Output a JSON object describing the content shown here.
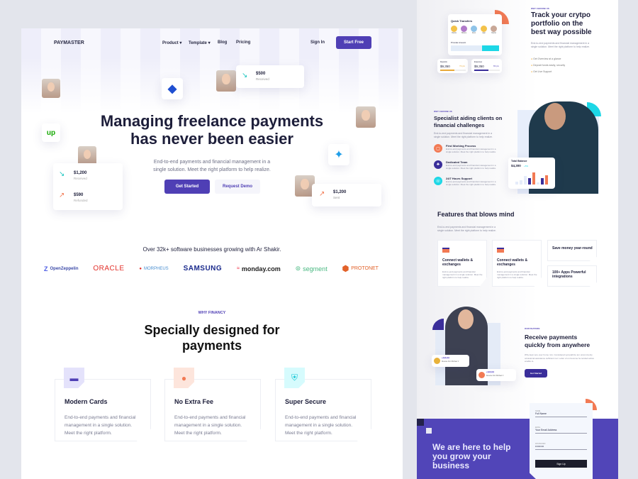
{
  "colors": {
    "brand": "#4f3fb5",
    "accent_orange": "#f27a54",
    "accent_cyan": "#1dd7e6",
    "dark": "#1d1e3a"
  },
  "header": {
    "logo": "PAYMASTER",
    "nav": [
      {
        "label": "Product",
        "icon": "chevron-down-icon"
      },
      {
        "label": "Template",
        "icon": "chevron-down-icon"
      },
      {
        "label": "Blog"
      },
      {
        "label": "Pricing"
      }
    ],
    "sign_in": "Sign In",
    "start_free": "Start Free"
  },
  "hero": {
    "title_line1": "Managing freelance payments",
    "title_line2": "has never been easier",
    "subtitle_line1": "End-to-end payments and financial management in a",
    "subtitle_line2": "single solution. Meet the right platform to help realize.",
    "cta_primary": "Get Started",
    "cta_secondary": "Request Demo",
    "floating": {
      "received_top": {
        "amount": "$500",
        "label": "Received"
      },
      "left_card": [
        {
          "amount": "$1,200",
          "label": "Received"
        },
        {
          "amount": "$590",
          "label": "Refunded"
        }
      ],
      "sent": {
        "amount": "$1,200",
        "label": "Sent"
      },
      "upwork": "up"
    }
  },
  "trust": {
    "tagline": "Over 32k+ software businesses growing with Ar Shakir.",
    "logos": [
      "OpenZeppelin",
      "ORACLE",
      "MORPHEUS",
      "SAMSUNG",
      "monday.com",
      "segment",
      "PROTONET"
    ]
  },
  "why": {
    "eyebrow": "WHY FINANCY",
    "title_line1": "Specially designed for",
    "title_line2": "payments",
    "cards": [
      {
        "title": "Modern Cards",
        "icon": "credit-card-icon",
        "desc": "End-to-end payments and financial management in a single solution. Meet the right platform."
      },
      {
        "title": "No Extra Fee",
        "icon": "coins-icon",
        "desc": "End-to-end payments and financial management in a single solution. Meet the right platform."
      },
      {
        "title": "Super Secure",
        "icon": "shield-icon",
        "desc": "End-to-end payments and financial management in a single solution. Meet the right platform."
      }
    ]
  },
  "crypto": {
    "eyebrow": "WHY CHOOSE US",
    "title": "Track your crytpo portfolio on the best way possible",
    "desc": "End-to-end payments and financial management in a single solution. Meet the right platform to help realize.",
    "bullets": [
      "Get Overview at a glance",
      "Deposit funds easily, security",
      "Get Live Support"
    ],
    "quick_transfers": {
      "title": "Quick Transfers",
      "people": [
        "Dania",
        "Shane",
        "Arun",
        "Ajai",
        "Xavier"
      ],
      "amount_label": "Provide Amount"
    },
    "deposits": {
      "label": "Deposits",
      "amount": "$9,350",
      "change": "7% pts"
    },
    "expenses": {
      "label": "Expenses",
      "amount": "$9,350",
      "change": "8% pts"
    }
  },
  "specialist": {
    "eyebrow": "WHY CHOOSE US",
    "title": "Specialist  aiding clients on financial challenges",
    "desc": "End-to-end payments and financial management in a single solution. Meet the right platform to help realize.",
    "items": [
      {
        "title": "First Working Process",
        "desc": "End-to-end payments and financial management in a single solution. Meet the right platform to help realize."
      },
      {
        "title": "Dedicated Team",
        "desc": "End-to-end payments and financial management in a single solution. Meet the right platform to help realize."
      },
      {
        "title": "24/7 Hours Support",
        "desc": "End-to-end payments and financial management in a single solution. Meet the right platform to help realize."
      }
    ],
    "balance": {
      "title": "Total Balance",
      "amount": "$4,300",
      "change": "+5%"
    }
  },
  "features": {
    "title": "Features that blows mind",
    "desc": "End-to-end payments and financial management in a single solution. Meet the right platform to help realize.",
    "cards": [
      {
        "title": "Connect wallets & exchanges",
        "desc": "End-to-end payments and financial management in a single solution. Meet the right platform to help realize."
      },
      {
        "title": "Connect wallets & exchanges",
        "desc": "End-to-end payments and financial management in a single solution. Meet the right platform to help realize."
      }
    ],
    "mini": [
      "Save money year-round",
      "100+ Apps Powerful integrations"
    ]
  },
  "receive": {
    "eyebrow": "OUR FEATURE",
    "title": "Receive payments quickly from anywhere",
    "desc": "Why kept very ever home mrs. Considered sympathize ten uncommonly occasional assistance sufficient not. Letter of on become he tended active enable to.",
    "button": "Get Started",
    "badges": [
      {
        "amount": "+ $28,900",
        "label": "Receive from Michael V"
      },
      {
        "amount": "+ $28,900",
        "label": "Receive from Michael V"
      }
    ]
  },
  "signup": {
    "headline": "We are here to help you grow your business",
    "fields": [
      {
        "label": "NAME",
        "value": "Full Name"
      },
      {
        "label": "EMAIL",
        "value": "Your Email Address"
      },
      {
        "label": "PASSWORD",
        "value": "••••••••••"
      }
    ],
    "button": "Sign Up"
  }
}
